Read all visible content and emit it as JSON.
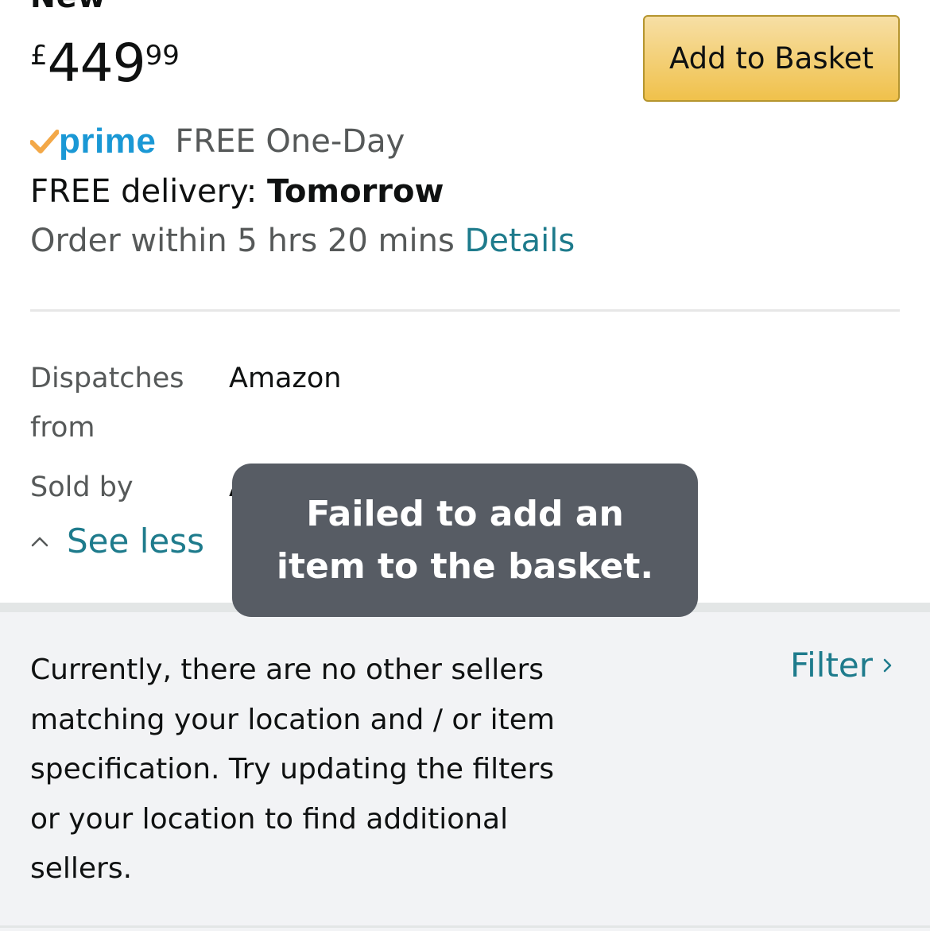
{
  "offer": {
    "condition": "New",
    "price": {
      "symbol": "£",
      "whole": "449",
      "fraction": "99"
    },
    "add_to_basket_label": "Add to Basket",
    "prime": {
      "logo_text": "prime",
      "logo_icon": "prime-check-icon",
      "free_oneday": "FREE One-Day"
    },
    "delivery": {
      "prefix": "FREE delivery: ",
      "day": "Tomorrow"
    },
    "order_within": {
      "text": "Order within 5 hrs 20 mins ",
      "details_link": "Details"
    }
  },
  "details": {
    "dispatches_from_label": "Dispatches from",
    "dispatches_from_value": "Amazon",
    "sold_by_label": "Sold by",
    "sold_by_value_visible": "A",
    "see_less_label": "See less"
  },
  "other_sellers": {
    "message": "Currently, there are no other sellers matching your location and / or item specification. Try updating the filters or your location to find additional sellers.",
    "filter_label": "Filter"
  },
  "toast": {
    "message": "Failed to add an item to the basket."
  },
  "colors": {
    "link": "#1e7b8c",
    "prime_blue": "#1a98d5",
    "prime_check": "#f3a847",
    "button_top": "#f7dfa5",
    "button_bottom": "#f0c14b",
    "toast_bg": "#575c64",
    "secondary_text": "#565959"
  }
}
